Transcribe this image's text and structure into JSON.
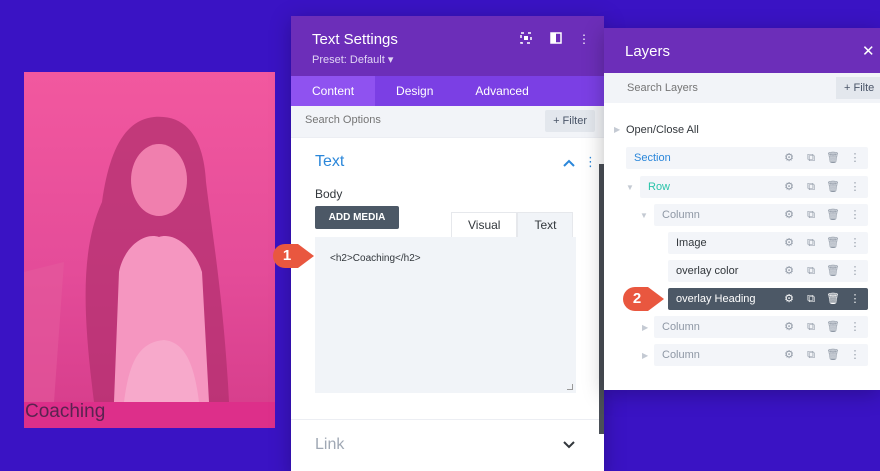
{
  "preview": {
    "heading": "Coaching"
  },
  "text_settings": {
    "title": "Text Settings",
    "preset": "Preset: Default ▾",
    "tabs": [
      "Content",
      "Design",
      "Advanced"
    ],
    "search_placeholder": "Search Options",
    "filter_label": "+ Filter",
    "section_title": "Text",
    "body_label": "Body",
    "add_media_label": "ADD MEDIA",
    "editor_tabs": [
      "Visual",
      "Text"
    ],
    "editor_content": "<h2>Coaching</h2>",
    "link_title": "Link"
  },
  "layers": {
    "title": "Layers",
    "search_placeholder": "Search Layers",
    "filter_label": "+ Filte",
    "open_close_all": "Open/Close All",
    "items": [
      {
        "label": "Section",
        "color": "#2b87da"
      },
      {
        "label": "Row",
        "color": "#29c4a9"
      },
      {
        "label": "Column",
        "color": "#8f98a5"
      },
      {
        "label": "Image",
        "color": "#32373c"
      },
      {
        "label": "overlay color",
        "color": "#32373c"
      },
      {
        "label": "overlay Heading",
        "color": "#ffffff"
      },
      {
        "label": "Column",
        "color": "#8f98a5"
      },
      {
        "label": "Column",
        "color": "#8f98a5"
      }
    ]
  },
  "callouts": [
    "1",
    "2"
  ],
  "colors": {
    "background": "#3a13c4",
    "header": "#6c2eb9",
    "tabs": "#7b3fe4",
    "accent_pink": "#e8398f",
    "callout": "#e9573f"
  }
}
